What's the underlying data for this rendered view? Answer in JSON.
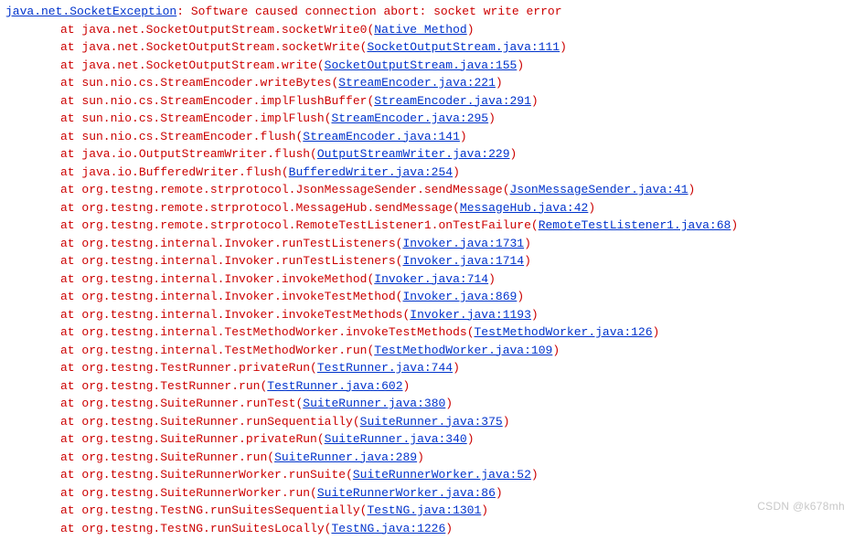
{
  "exception": {
    "class": "java.net.SocketException",
    "message": "Software caused connection abort: socket write error"
  },
  "frames": [
    {
      "method": "java.net.SocketOutputStream.socketWrite0",
      "source": "Native Method"
    },
    {
      "method": "java.net.SocketOutputStream.socketWrite",
      "source": "SocketOutputStream.java:111"
    },
    {
      "method": "java.net.SocketOutputStream.write",
      "source": "SocketOutputStream.java:155"
    },
    {
      "method": "sun.nio.cs.StreamEncoder.writeBytes",
      "source": "StreamEncoder.java:221"
    },
    {
      "method": "sun.nio.cs.StreamEncoder.implFlushBuffer",
      "source": "StreamEncoder.java:291"
    },
    {
      "method": "sun.nio.cs.StreamEncoder.implFlush",
      "source": "StreamEncoder.java:295"
    },
    {
      "method": "sun.nio.cs.StreamEncoder.flush",
      "source": "StreamEncoder.java:141"
    },
    {
      "method": "java.io.OutputStreamWriter.flush",
      "source": "OutputStreamWriter.java:229"
    },
    {
      "method": "java.io.BufferedWriter.flush",
      "source": "BufferedWriter.java:254"
    },
    {
      "method": "org.testng.remote.strprotocol.JsonMessageSender.sendMessage",
      "source": "JsonMessageSender.java:41"
    },
    {
      "method": "org.testng.remote.strprotocol.MessageHub.sendMessage",
      "source": "MessageHub.java:42"
    },
    {
      "method": "org.testng.remote.strprotocol.RemoteTestListener1.onTestFailure",
      "source": "RemoteTestListener1.java:68"
    },
    {
      "method": "org.testng.internal.Invoker.runTestListeners",
      "source": "Invoker.java:1731"
    },
    {
      "method": "org.testng.internal.Invoker.runTestListeners",
      "source": "Invoker.java:1714"
    },
    {
      "method": "org.testng.internal.Invoker.invokeMethod",
      "source": "Invoker.java:714"
    },
    {
      "method": "org.testng.internal.Invoker.invokeTestMethod",
      "source": "Invoker.java:869"
    },
    {
      "method": "org.testng.internal.Invoker.invokeTestMethods",
      "source": "Invoker.java:1193"
    },
    {
      "method": "org.testng.internal.TestMethodWorker.invokeTestMethods",
      "source": "TestMethodWorker.java:126"
    },
    {
      "method": "org.testng.internal.TestMethodWorker.run",
      "source": "TestMethodWorker.java:109"
    },
    {
      "method": "org.testng.TestRunner.privateRun",
      "source": "TestRunner.java:744"
    },
    {
      "method": "org.testng.TestRunner.run",
      "source": "TestRunner.java:602"
    },
    {
      "method": "org.testng.SuiteRunner.runTest",
      "source": "SuiteRunner.java:380"
    },
    {
      "method": "org.testng.SuiteRunner.runSequentially",
      "source": "SuiteRunner.java:375"
    },
    {
      "method": "org.testng.SuiteRunner.privateRun",
      "source": "SuiteRunner.java:340"
    },
    {
      "method": "org.testng.SuiteRunner.run",
      "source": "SuiteRunner.java:289"
    },
    {
      "method": "org.testng.SuiteRunnerWorker.runSuite",
      "source": "SuiteRunnerWorker.java:52"
    },
    {
      "method": "org.testng.SuiteRunnerWorker.run",
      "source": "SuiteRunnerWorker.java:86"
    },
    {
      "method": "org.testng.TestNG.runSuitesSequentially",
      "source": "TestNG.java:1301"
    },
    {
      "method": "org.testng.TestNG.runSuitesLocally",
      "source": "TestNG.java:1226"
    }
  ],
  "watermark": "CSDN @k678mh"
}
